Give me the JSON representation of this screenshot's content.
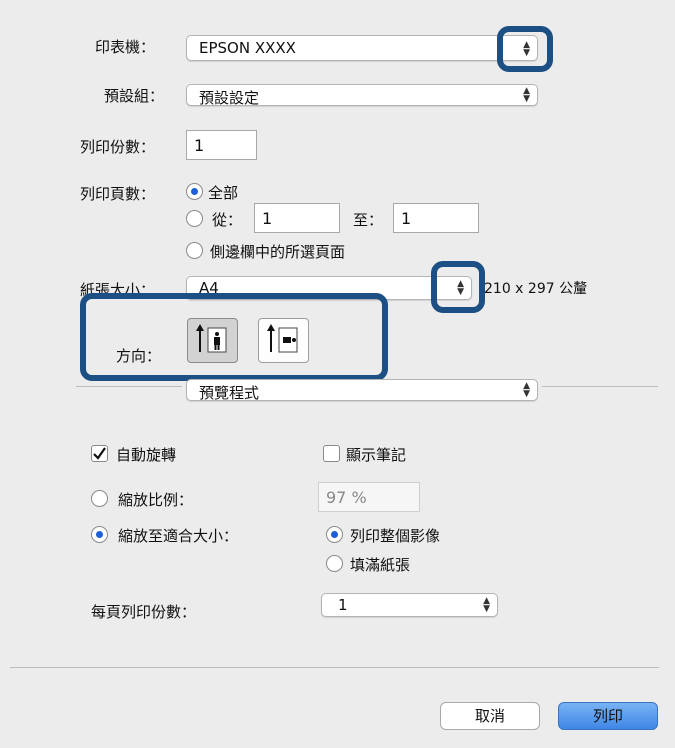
{
  "printer": {
    "label": "印表機：",
    "value": "EPSON XXXX"
  },
  "presets": {
    "label": "預設組：",
    "value": "預設設定"
  },
  "copies": {
    "label": "列印份數：",
    "value": "1"
  },
  "pages": {
    "label": "列印頁數：",
    "all_label": "全部",
    "from_label": "從：",
    "from_value": "1",
    "to_label": "至：",
    "to_value": "1",
    "selected_label": "側邊欄中的所選頁面",
    "selected_option": "all"
  },
  "paper_size": {
    "label": "紙張大小：",
    "value": "A4",
    "dimensions": "210 x 297 公釐"
  },
  "orientation": {
    "label": "方向：",
    "selected": "portrait"
  },
  "app_section": {
    "value": "預覽程式"
  },
  "options": {
    "auto_rotate_label": "自動旋轉",
    "auto_rotate_checked": true,
    "show_notes_label": "顯示筆記",
    "show_notes_checked": false,
    "scale_label": "縮放比例：",
    "scale_value": "97 %",
    "scale_to_fit_label": "縮放至適合大小：",
    "scale_mode": "fit",
    "print_entire_label": "列印整個影像",
    "fill_paper_label": "填滿紙張",
    "fit_mode": "entire"
  },
  "copies_per_page": {
    "label": "每頁列印份數：",
    "value": "1"
  },
  "buttons": {
    "cancel": "取消",
    "print": "列印"
  },
  "colors": {
    "highlight": "#1c4f84",
    "accent": "#1c5fd6"
  }
}
